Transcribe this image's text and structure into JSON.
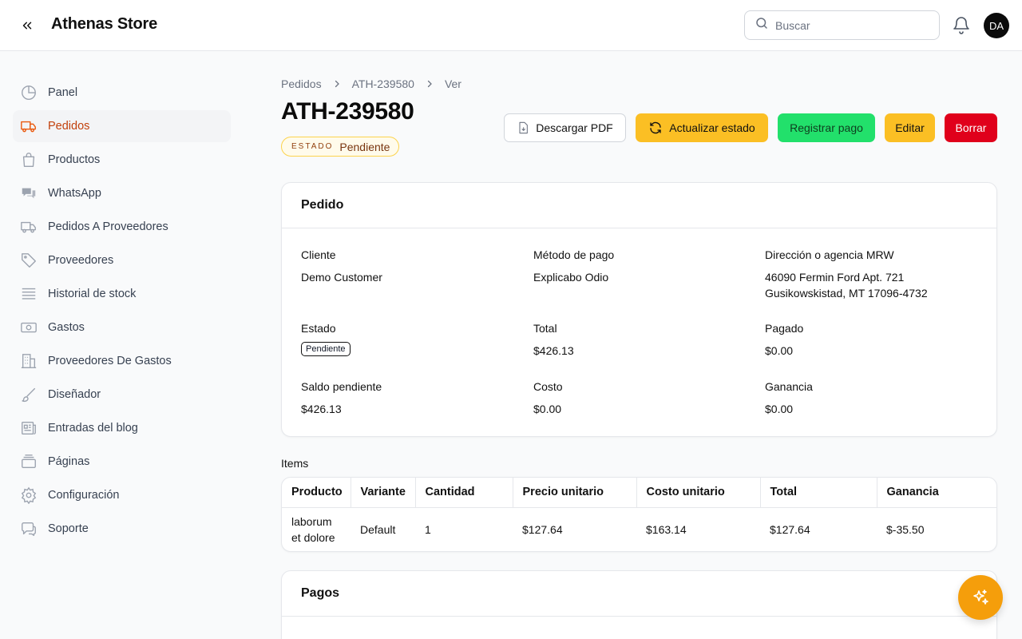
{
  "app": {
    "brand": "Athenas Store"
  },
  "header": {
    "search_placeholder": "Buscar",
    "avatar_initials": "DA"
  },
  "sidebar": {
    "items": [
      {
        "label": "Panel",
        "icon": "pie-chart-icon"
      },
      {
        "label": "Pedidos",
        "icon": "truck-icon",
        "active": true
      },
      {
        "label": "Productos",
        "icon": "shopping-bag-icon"
      },
      {
        "label": "WhatsApp",
        "icon": "chat-bubbles-icon"
      },
      {
        "label": "Pedidos A Proveedores",
        "icon": "truck-outline-icon"
      },
      {
        "label": "Proveedores",
        "icon": "tag-icon"
      },
      {
        "label": "Historial de stock",
        "icon": "stack-icon"
      },
      {
        "label": "Gastos",
        "icon": "banknote-icon"
      },
      {
        "label": "Proveedores De Gastos",
        "icon": "building-icon"
      },
      {
        "label": "Diseñador",
        "icon": "paintbrush-icon"
      },
      {
        "label": "Entradas del blog",
        "icon": "newspaper-icon"
      },
      {
        "label": "Páginas",
        "icon": "pages-icon"
      },
      {
        "label": "Configuración",
        "icon": "gear-icon"
      },
      {
        "label": "Soporte",
        "icon": "support-chat-icon"
      }
    ]
  },
  "breadcrumb": [
    "Pedidos",
    "ATH-239580",
    "Ver"
  ],
  "page": {
    "title": "ATH-239580",
    "state_label": "ESTADO",
    "state_value": "Pendiente"
  },
  "actions": {
    "pdf": "Descargar PDF",
    "update_status": "Actualizar estado",
    "register_payment": "Registrar pago",
    "edit": "Editar",
    "delete": "Borrar"
  },
  "order": {
    "heading": "Pedido",
    "client_label": "Cliente",
    "client": "Demo Customer",
    "payment_method_label": "Método de pago",
    "payment_method": "Explicabo Odio",
    "address_label": "Dirección o agencia MRW",
    "address_line1": "46090 Fermin Ford Apt. 721",
    "address_line2": "Gusikowskistad, MT 17096-4732",
    "status_label": "Estado",
    "status": "Pendiente",
    "total_label": "Total",
    "total": "$426.13",
    "paid_label": "Pagado",
    "paid": "$0.00",
    "balance_label": "Saldo pendiente",
    "balance": "$426.13",
    "cost_label": "Costo",
    "cost": "$0.00",
    "profit_label": "Ganancia",
    "profit": "$0.00"
  },
  "items": {
    "label": "Items",
    "columns": [
      "Producto",
      "Variante",
      "Cantidad",
      "Precio unitario",
      "Costo unitario",
      "Total",
      "Ganancia"
    ],
    "rows": [
      {
        "product_line1": "laborum",
        "product_line2": "et dolore",
        "variant": "Default",
        "qty": "1",
        "unit_price": "$127.64",
        "unit_cost": "$163.14",
        "total": "$127.64",
        "profit": "$-35.50"
      }
    ]
  },
  "payments": {
    "heading": "Pagos"
  },
  "colors": {
    "accent": "#ea580c",
    "warning_button": "#fbbf24",
    "success_button": "#22e06b",
    "danger_button": "#e0001b",
    "fab": "#f59e0b"
  }
}
